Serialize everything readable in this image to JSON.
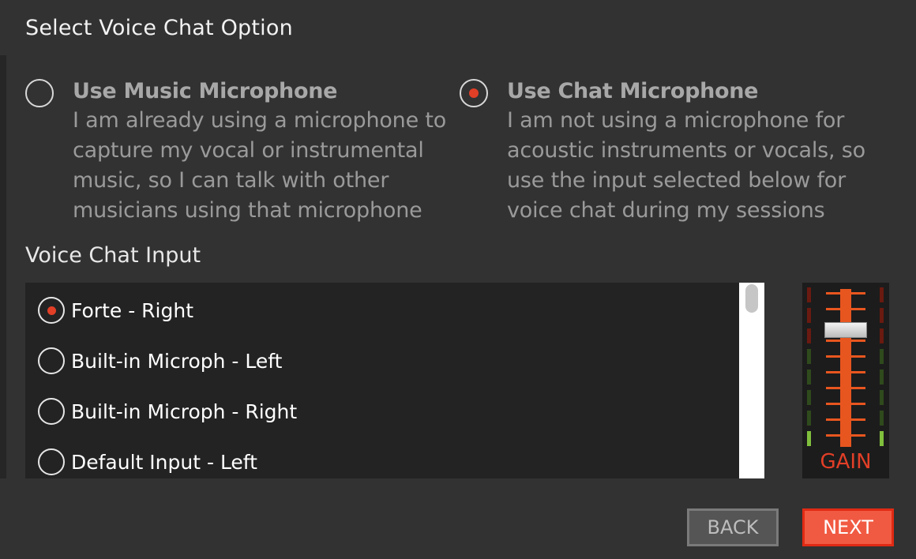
{
  "title": "Select Voice Chat Option",
  "options": [
    {
      "heading": "Use Music Microphone",
      "description": "I am already using a microphone to capture my vocal or instrumental music, so I can talk with other musicians using that microphone",
      "selected": false
    },
    {
      "heading": "Use Chat Microphone",
      "description": "I am not using a microphone for acoustic instruments or vocals, so use the input selected below for voice chat during my sessions",
      "selected": true
    }
  ],
  "voice_chat_input": {
    "label": "Voice Chat Input",
    "items": [
      {
        "label": "Forte - Right",
        "selected": true
      },
      {
        "label": "Built-in Microph - Left",
        "selected": false
      },
      {
        "label": "Built-in Microph - Right",
        "selected": false
      },
      {
        "label": "Default Input - Left",
        "selected": false
      }
    ]
  },
  "gain": {
    "label": "GAIN"
  },
  "buttons": {
    "back": "BACK",
    "next": "NEXT"
  },
  "colors": {
    "accent": "#e23f27",
    "background": "#323232",
    "next_button": "#f15a42",
    "fader": "#e8561f"
  }
}
